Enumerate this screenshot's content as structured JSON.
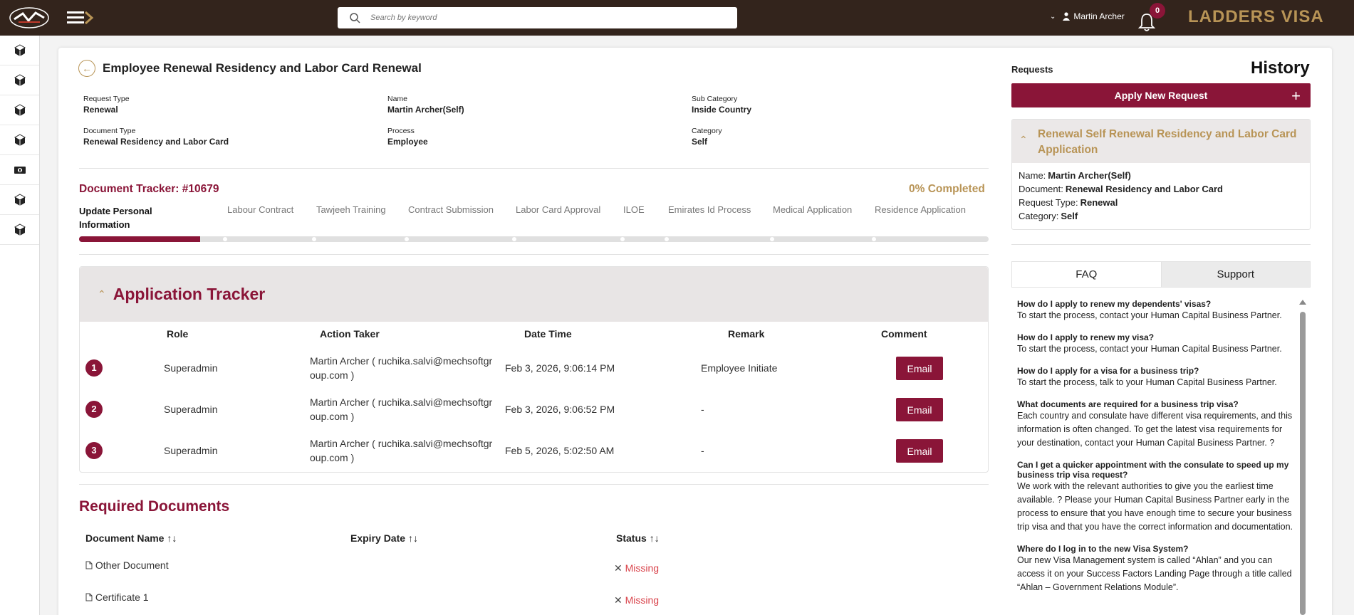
{
  "header": {
    "search_placeholder": "Search by keyword",
    "user_name": "Martin Archer",
    "notification_count": "0",
    "brand": "LADDERS VISA"
  },
  "page": {
    "title": "Employee Renewal Residency and Labor Card Renewal",
    "meta": [
      {
        "label": "Request Type",
        "value": "Renewal"
      },
      {
        "label": "Name",
        "value": "Martin Archer(Self)"
      },
      {
        "label": "Sub Category",
        "value": "Inside Country"
      },
      {
        "label": "Document Type",
        "value": "Renewal Residency and Labor Card"
      },
      {
        "label": "Process",
        "value": "Employee"
      },
      {
        "label": "Category",
        "value": "Self"
      }
    ]
  },
  "tracker": {
    "title": "Document Tracker: #10679",
    "completed": "0% Completed",
    "progress_fraction": 0.133,
    "steps": [
      {
        "label": "Update Personal Information",
        "active": true
      },
      {
        "label": "Labour Contract"
      },
      {
        "label": "Tawjeeh Training"
      },
      {
        "label": "Contract Submission"
      },
      {
        "label": "Labor Card Approval"
      },
      {
        "label": "ILOE"
      },
      {
        "label": "Emirates Id Process"
      },
      {
        "label": "Medical Application"
      },
      {
        "label": "Residence Application"
      }
    ]
  },
  "application_tracker": {
    "title": "Application Tracker",
    "columns": [
      "Role",
      "Action Taker",
      "Date Time",
      "Remark",
      "Comment"
    ],
    "rows": [
      {
        "num": "1",
        "role": "Superadmin",
        "taker_1": "Martin Archer ( ruchika.salvi@mechsoftgr",
        "taker_2": "oup.com )",
        "datetime": "Feb 3, 2026, 9:06:14 PM",
        "remark": "Employee Initiate",
        "comment": "Email"
      },
      {
        "num": "2",
        "role": "Superadmin",
        "taker_1": "Martin Archer ( ruchika.salvi@mechsoftgr",
        "taker_2": "oup.com )",
        "datetime": "Feb 3, 2026, 9:06:52 PM",
        "remark": "-",
        "comment": "Email"
      },
      {
        "num": "3",
        "role": "Superadmin",
        "taker_1": "Martin Archer ( ruchika.salvi@mechsoftgr",
        "taker_2": "oup.com )",
        "datetime": "Feb 5, 2026, 5:02:50 AM",
        "remark": "-",
        "comment": "Email"
      }
    ]
  },
  "required_documents": {
    "title": "Required Documents",
    "columns": [
      "Document Name",
      "Expiry Date",
      "Status"
    ],
    "sort_icon": "↑↓",
    "rows": [
      {
        "name": "Other Document",
        "status": "Missing"
      },
      {
        "name": "Certificate 1",
        "status": "Missing"
      }
    ]
  },
  "right": {
    "requests_label": "Requests",
    "history_title": "History",
    "apply_label": "Apply New Request",
    "history_card": {
      "title": "Renewal Self Renewal Residency and Labor Card Application",
      "lines": [
        {
          "label": "Name:",
          "value": "Martin Archer(Self)"
        },
        {
          "label": "Document:",
          "value": "Renewal Residency and Labor Card"
        },
        {
          "label": "Request Type:",
          "value": "Renewal"
        },
        {
          "label": "Category:",
          "value": "Self"
        }
      ]
    },
    "tabs": [
      "FAQ",
      "Support"
    ],
    "faq": [
      {
        "q": "How do I apply to renew my dependents' visas?",
        "a": "To start the process, contact your Human Capital Business Partner."
      },
      {
        "q": "How do I apply to renew my visa?",
        "a": "To start the process, contact your Human Capital Business Partner."
      },
      {
        "q": "How do I apply for a visa for a business trip?",
        "a": "To start the process, talk to your Human Capital Business Partner."
      },
      {
        "q": "What documents are required for a business trip visa?",
        "a": "Each country and consulate have different visa requirements, and this information is often changed. To get the latest visa requirements for your destination, contact your Human Capital Business Partner. ?"
      },
      {
        "q": "Can I get a quicker appointment with the consulate to speed up my business trip visa request?",
        "a": "We work with the relevant authorities to give you the earliest time available. ? Please your Human Capital Business Partner early in the process to ensure that you have enough time to secure your business trip visa and that you have the correct information and documentation."
      },
      {
        "q": "Where do I log in to the new Visa System?",
        "a": "Our new Visa Management system is called “Ahlan” and you can access it on your Success Factors Landing Page through a title called “Ahlan – Government Relations Module”."
      }
    ]
  },
  "colors": {
    "primary": "#8a1538",
    "gold": "#b89456",
    "topbar": "#33241c",
    "missing": "#d9434b"
  }
}
